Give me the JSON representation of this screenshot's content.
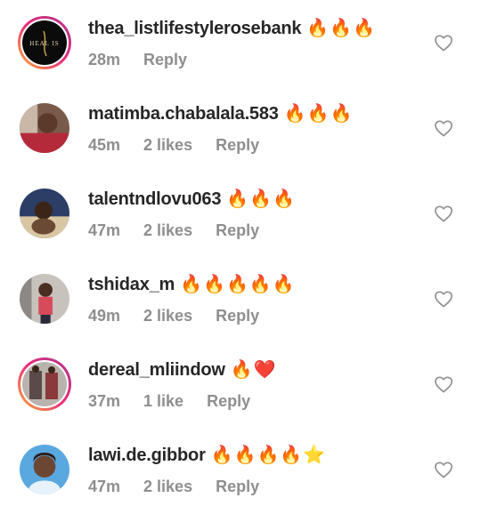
{
  "comments": [
    {
      "username": "thea_listlifestylerosebank",
      "emojis": "🔥🔥🔥",
      "time": "28m",
      "likes": "",
      "reply": "Reply",
      "avatar": "brand-logo-avatar",
      "ring": true
    },
    {
      "username": "matimba.chabalala.583",
      "emojis": "🔥🔥🔥",
      "time": "45m",
      "likes": "2 likes",
      "reply": "Reply",
      "avatar": "user-photo-avatar",
      "ring": false
    },
    {
      "username": "talentndlovu063",
      "emojis": "🔥🔥🔥",
      "time": "47m",
      "likes": "2 likes",
      "reply": "Reply",
      "avatar": "user-photo-avatar",
      "ring": false
    },
    {
      "username": "tshidax_m",
      "emojis": "🔥🔥🔥🔥🔥",
      "time": "49m",
      "likes": "2 likes",
      "reply": "Reply",
      "avatar": "user-photo-avatar",
      "ring": false
    },
    {
      "username": "dereal_mliindow",
      "emojis": "🔥❤️",
      "time": "37m",
      "likes": "1 like",
      "reply": "Reply",
      "avatar": "user-photo-avatar",
      "ring": true
    },
    {
      "username": "lawi.de.gibbor",
      "emojis": "🔥🔥🔥🔥⭐",
      "time": "47m",
      "likes": "2 likes",
      "reply": "Reply",
      "avatar": "user-photo-avatar",
      "ring": false
    }
  ],
  "icons": {
    "like": "heart-outline-icon"
  },
  "colors": {
    "text": "#262626",
    "meta": "#8e8e8e",
    "ring_start": "#f9b233",
    "ring_end": "#d6249f"
  }
}
